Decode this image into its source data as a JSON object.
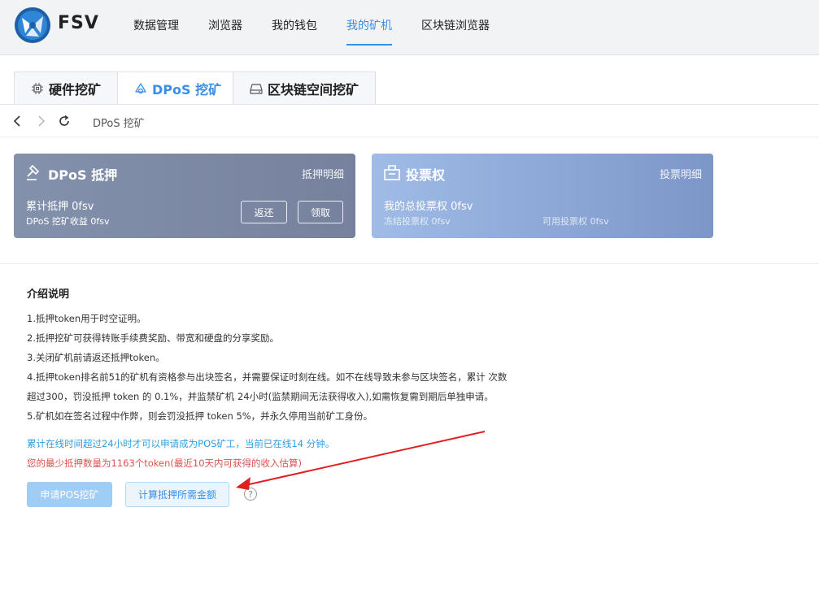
{
  "header": {
    "brand": "FSV",
    "nav": [
      {
        "label": "数据管理"
      },
      {
        "label": "浏览器"
      },
      {
        "label": "我的钱包"
      },
      {
        "label": "我的矿机"
      },
      {
        "label": "区块链浏览器"
      }
    ],
    "active_nav": "我的矿机"
  },
  "tabs": [
    {
      "label": "硬件挖矿"
    },
    {
      "label": "DPoS 挖矿"
    },
    {
      "label": "区块链空间挖矿"
    }
  ],
  "browser_bar": {
    "label": "DPoS 挖矿"
  },
  "dpos_card": {
    "title": "DPoS 抵押",
    "link": "抵押明细",
    "total": "累计抵押 0fsv",
    "income": "DPoS 挖矿收益 0fsv",
    "return_btn": "返还",
    "claim_btn": "领取"
  },
  "vote_card": {
    "title": "投票权",
    "link": "投票明细",
    "total": "我的总投票权 0fsv",
    "frozen": "冻结投票权 0fsv",
    "available": "可用投票权 0fsv"
  },
  "intro": {
    "title": "介绍说明",
    "lines": [
      "1.抵押token用于时空证明。",
      "2.抵押挖矿可获得转账手续费奖励、带宽和硬盘的分享奖励。",
      "3.关闭矿机前请返还抵押token。",
      "4.抵押token排名前51的矿机有资格参与出块签名，并需要保证时刻在线。如不在线导致未参与区块签名，累计 次数",
      "超过300，罚没抵押 token 的 0.1%，并监禁矿机 24小时(监禁期间无法获得收入),如需恢复需到期后单独申请。",
      "5.矿机如在签名过程中作弊，则会罚没抵押 token 5%，并永久停用当前矿工身份。"
    ],
    "note_online": "累计在线时间超过24小时才可以申请成为POS矿工，当前已在线14 分钟。",
    "note_min": "您的最少抵押数量为1163个token(最近10天内可获得的收入估算)"
  },
  "actions": {
    "apply_btn": "申请POS挖矿",
    "calc_btn": "计算抵押所需金额",
    "help": "?"
  },
  "colors": {
    "accent": "#3a8ee6",
    "note_blue": "#2e9ee0",
    "note_red": "#d9534f",
    "arrow": "#e02020"
  }
}
